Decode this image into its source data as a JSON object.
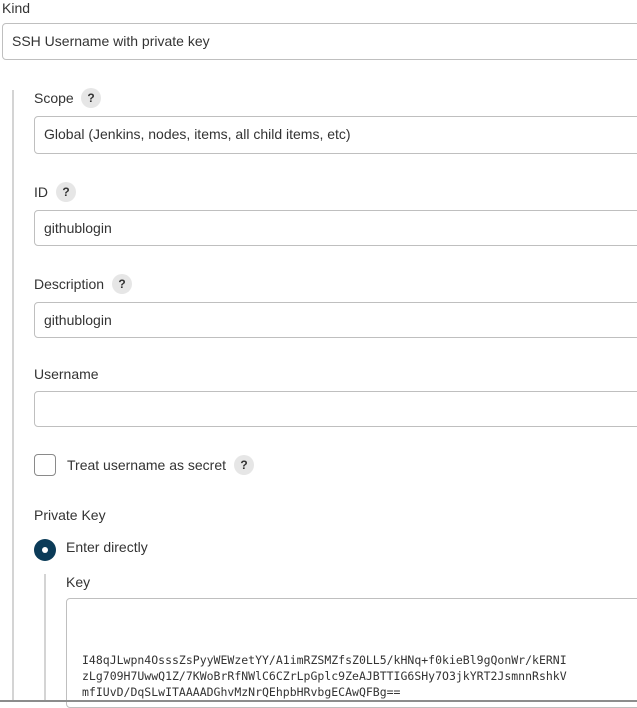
{
  "kind": {
    "label": "Kind",
    "value": "SSH Username with private key"
  },
  "scope": {
    "label": "Scope",
    "value": "Global (Jenkins, nodes, items, all child items, etc)"
  },
  "id_field": {
    "label": "ID",
    "value": "githublogin"
  },
  "description": {
    "label": "Description",
    "value": "githublogin"
  },
  "username": {
    "label": "Username",
    "value": ""
  },
  "treat_secret": {
    "label": "Treat username as secret",
    "checked": false
  },
  "private_key": {
    "label": "Private Key",
    "option_label": "Enter directly",
    "selected": true,
    "key_label": "Key",
    "key_lines": [
      "I48qJLwpn4OsssZsPyyWEWzetYY/A1imRZSMZfsZ0LL5/kHNq+f0kieBl9gQonWr/kERNI",
      "zLg709H7UwwQ1Z/7KWoBrRfNWlC6CZrLpGplc9ZeAJBTTIG6SHy7O3jkYRT2JsmnnRshkV",
      "mfIUvD/DqSLwITAAAADGhvMzNrQEhpbHRvbgECAwQFBg=="
    ]
  },
  "help_symbol": "?",
  "colors": {
    "radio_fill": "#0b3b58",
    "border": "#bfbfbf",
    "help_bg": "#e6e6e6"
  }
}
